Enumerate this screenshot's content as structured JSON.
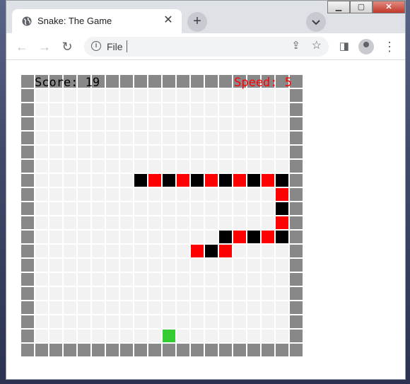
{
  "browser": {
    "tab_title": "Snake: The Game",
    "address_text": "File"
  },
  "game": {
    "score_label": "Score: 19",
    "speed_label": "Speed: 5",
    "score": 19,
    "speed": 5,
    "grid_size": 20,
    "colors": {
      "wall": "#888888",
      "empty": "#f2f2f2",
      "snake_dark": "#000000",
      "snake_light": "#ff0000",
      "food": "#33cc33",
      "score_text": "#000000",
      "speed_text": "#ff0000"
    },
    "snake": [
      [
        8,
        7
      ],
      [
        9,
        7
      ],
      [
        10,
        7
      ],
      [
        11,
        7
      ],
      [
        12,
        7
      ],
      [
        13,
        7
      ],
      [
        14,
        7
      ],
      [
        15,
        7
      ],
      [
        16,
        7
      ],
      [
        17,
        7
      ],
      [
        18,
        7
      ],
      [
        18,
        8
      ],
      [
        18,
        9
      ],
      [
        18,
        10
      ],
      [
        18,
        11
      ],
      [
        17,
        11
      ],
      [
        16,
        11
      ],
      [
        15,
        11
      ],
      [
        14,
        11
      ],
      [
        14,
        12
      ],
      [
        13,
        12
      ],
      [
        12,
        12
      ]
    ],
    "snake_colors": [
      "dark",
      "light",
      "dark",
      "light",
      "dark",
      "light",
      "dark",
      "light",
      "dark",
      "light",
      "dark",
      "light",
      "dark",
      "light",
      "dark",
      "light",
      "dark",
      "light",
      "dark",
      "light",
      "dark",
      "light"
    ],
    "food": [
      10,
      18
    ]
  }
}
